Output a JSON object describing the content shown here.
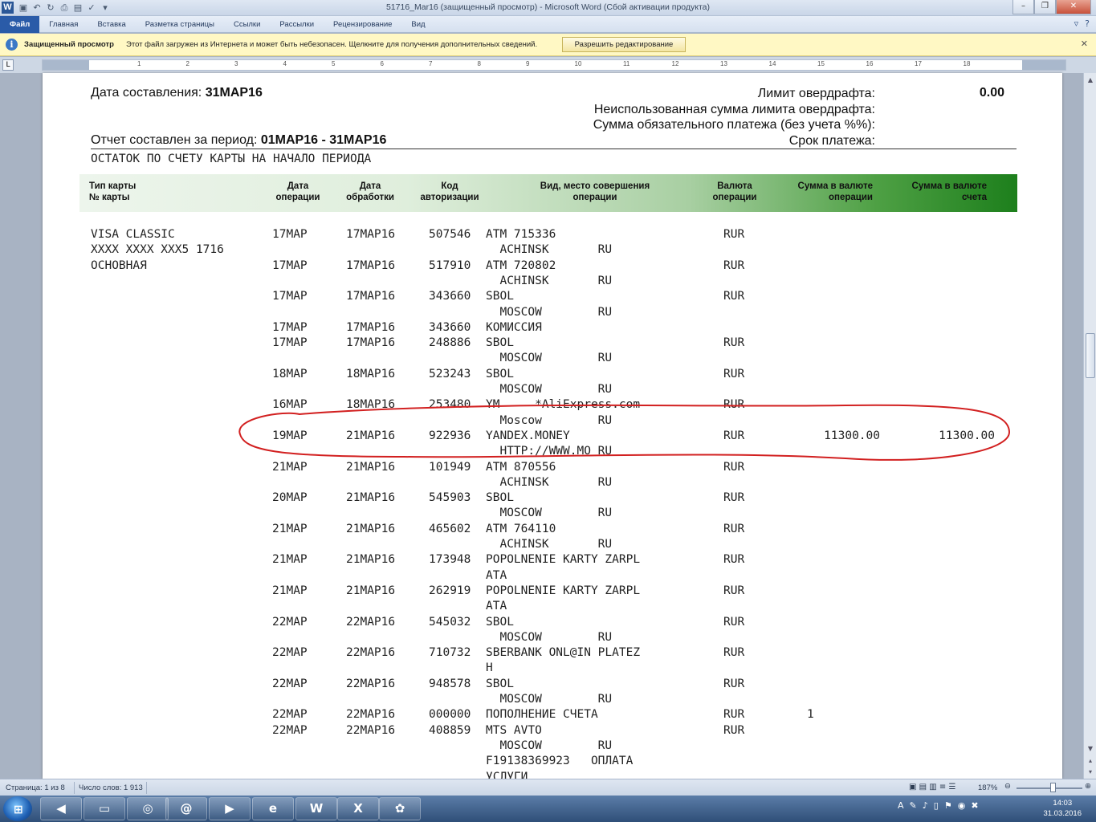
{
  "window": {
    "title": "51716_Mar16 (защищенный просмотр) - Microsoft Word (Сбой активации продукта)",
    "app_logo": "W",
    "controls": [
      "–",
      "❐",
      "✕"
    ]
  },
  "qat_icons": [
    "save-icon",
    "undo-icon",
    "redo-icon",
    "print-icon",
    "print-preview-icon",
    "spellcheck-icon",
    "customize-icon"
  ],
  "ribbon": {
    "tabs": [
      "Файл",
      "Главная",
      "Вставка",
      "Разметка страницы",
      "Ссылки",
      "Рассылки",
      "Рецензирование",
      "Вид"
    ]
  },
  "protected_view": {
    "title": "Защищенный просмотр",
    "message": "Этот файл загружен из Интернета и может быть небезопасен. Щелкните для получения дополнительных сведений.",
    "button": "Разрешить редактирование"
  },
  "ruler": {
    "numbers": [
      "1",
      "2",
      "3",
      "4",
      "5",
      "6",
      "7",
      "8",
      "9",
      "10",
      "11",
      "12",
      "13",
      "14",
      "15",
      "16",
      "17",
      "18"
    ]
  },
  "document": {
    "date_label": "Дата составления: ",
    "date_value": "31МАР16",
    "period_label": "Отчет составлен за период: ",
    "period_value": "01МАР16  - 31МАР16",
    "overdraft_limit_label": "Лимит овердрафта:",
    "overdraft_limit_value": "0.00",
    "unused_limit_label": "Неиспользованная сумма лимита овердрафта:",
    "mandatory_payment_label": "Сумма обязательного платежа (без учета %%):",
    "payment_due_label": "Срок платежа:",
    "balance_heading": "ОСТАТОК ПО СЧЕТУ КАРТЫ НА НАЧАЛО ПЕРИОДА",
    "columns": {
      "card_type": "Тип карты",
      "card_no": "№ карты",
      "op_date": [
        "Дата",
        "операции"
      ],
      "proc_date": [
        "Дата",
        "обработки"
      ],
      "auth_code": [
        "Код",
        "авторизации"
      ],
      "description": [
        "Вид, место совершения",
        "операции"
      ],
      "currency": [
        "Валюта",
        "операции"
      ],
      "amount_op": [
        "Сумма в валюте",
        "операции"
      ],
      "amount_acc": [
        "Сумма в валюте",
        "счета"
      ]
    },
    "card": [
      "VISA CLASSIC",
      "XXXX XXXX XXX5 1716",
      "ОСНОВНАЯ"
    ],
    "rows": [
      {
        "op": "17МАР",
        "proc": "17МАР16",
        "code": "507546",
        "d1": "ATM 715336",
        "d2": "  ACHINSK       RU",
        "cur": "RUR",
        "amt_op": "",
        "amt_acc": ""
      },
      {
        "op": "17МАР",
        "proc": "17МАР16",
        "code": "517910",
        "d1": "ATM 720802",
        "d2": "  ACHINSK       RU",
        "cur": "RUR",
        "amt_op": "",
        "amt_acc": ""
      },
      {
        "op": "17МАР",
        "proc": "17МАР16",
        "code": "343660",
        "d1": "SBOL",
        "d2": "  MOSCOW        RU",
        "cur": "RUR",
        "amt_op": "",
        "amt_acc": ""
      },
      {
        "op": "17МАР",
        "proc": "17МАР16",
        "code": "343660",
        "d1": "КОМИССИЯ",
        "d2": null,
        "cur": "",
        "amt_op": "",
        "amt_acc": ""
      },
      {
        "op": "17МАР",
        "proc": "17МАР16",
        "code": "248886",
        "d1": "SBOL",
        "d2": "  MOSCOW        RU",
        "cur": "RUR",
        "amt_op": "",
        "amt_acc": ""
      },
      {
        "op": "18МАР",
        "proc": "18МАР16",
        "code": "523243",
        "d1": "SBOL",
        "d2": "  MOSCOW        RU",
        "cur": "RUR",
        "amt_op": "",
        "amt_acc": ""
      },
      {
        "op": "16МАР",
        "proc": "18МАР16",
        "code": "253480",
        "d1": "YM     *AliExpress.com",
        "d2": "  Moscow        RU",
        "cur": "RUR",
        "amt_op": "",
        "amt_acc": ""
      },
      {
        "op": "19МАР",
        "proc": "21МАР16",
        "code": "922936",
        "d1": "YANDEX.MONEY",
        "d2": "  HTTP://WWW.MO RU",
        "cur": "RUR",
        "amt_op": "11300.00",
        "amt_acc": "11300.00"
      },
      {
        "op": "21МАР",
        "proc": "21МАР16",
        "code": "101949",
        "d1": "ATM 870556",
        "d2": "  ACHINSK       RU",
        "cur": "RUR",
        "amt_op": "",
        "amt_acc": ""
      },
      {
        "op": "20МАР",
        "proc": "21МАР16",
        "code": "545903",
        "d1": "SBOL",
        "d2": "  MOSCOW        RU",
        "cur": "RUR",
        "amt_op": "",
        "amt_acc": ""
      },
      {
        "op": "21МАР",
        "proc": "21МАР16",
        "code": "465602",
        "d1": "ATM 764110",
        "d2": "  ACHINSK       RU",
        "cur": "RUR",
        "amt_op": "",
        "amt_acc": ""
      },
      {
        "op": "21МАР",
        "proc": "21МАР16",
        "code": "173948",
        "d1": "POPOLNENIE KARTY ZARPL",
        "d2": "ATA",
        "cur": "RUR",
        "amt_op": "",
        "amt_acc": ""
      },
      {
        "op": "21МАР",
        "proc": "21МАР16",
        "code": "262919",
        "d1": "POPOLNENIE KARTY ZARPL",
        "d2": "ATA",
        "cur": "RUR",
        "amt_op": "",
        "amt_acc": ""
      },
      {
        "op": "22МАР",
        "proc": "22МАР16",
        "code": "545032",
        "d1": "SBOL",
        "d2": "  MOSCOW        RU",
        "cur": "RUR",
        "amt_op": "",
        "amt_acc": ""
      },
      {
        "op": "22МАР",
        "proc": "22МАР16",
        "code": "710732",
        "d1": "SBERBANK ONL@IN PLATEZ",
        "d2": "H",
        "cur": "RUR",
        "amt_op": "",
        "amt_acc": ""
      },
      {
        "op": "22МАР",
        "proc": "22МАР16",
        "code": "948578",
        "d1": "SBOL",
        "d2": "  MOSCOW        RU",
        "cur": "RUR",
        "amt_op": "",
        "amt_acc": ""
      },
      {
        "op": "22МАР",
        "proc": "22МАР16",
        "code": "000000",
        "d1": "ПОПОЛНЕНИЕ СЧЕТА",
        "d2": null,
        "cur": "RUR",
        "amt_op": "1",
        "amt_acc": ""
      },
      {
        "op": "22МАР",
        "proc": "22МАР16",
        "code": "408859",
        "d1": "MTS AVTO",
        "d2": "  MOSCOW        RU",
        "d3": "F19138369923   ОПЛАТА",
        "d4": "УСЛУГИ",
        "cur": "RUR",
        "amt_op": "",
        "amt_acc": ""
      }
    ]
  },
  "statusbar": {
    "page": "Страница: 1 из 8",
    "words": "Число слов: 1 913",
    "zoom": "187%"
  },
  "taskbar": {
    "items": [
      "explorer-icon",
      "media-icon",
      "folder-icon",
      "cd-icon",
      "mail-agent-icon",
      "media-player-icon",
      "ie-icon",
      "word-icon",
      "excel-icon",
      "icq-icon"
    ],
    "tray_language": "A",
    "time": "14:03",
    "date": "31.03.2016"
  },
  "colors": {
    "annotation": "#d22020",
    "header_green": "#1d7f1c",
    "file_tab": "#2a5ba8",
    "protected_bar": "#fff8c4"
  }
}
